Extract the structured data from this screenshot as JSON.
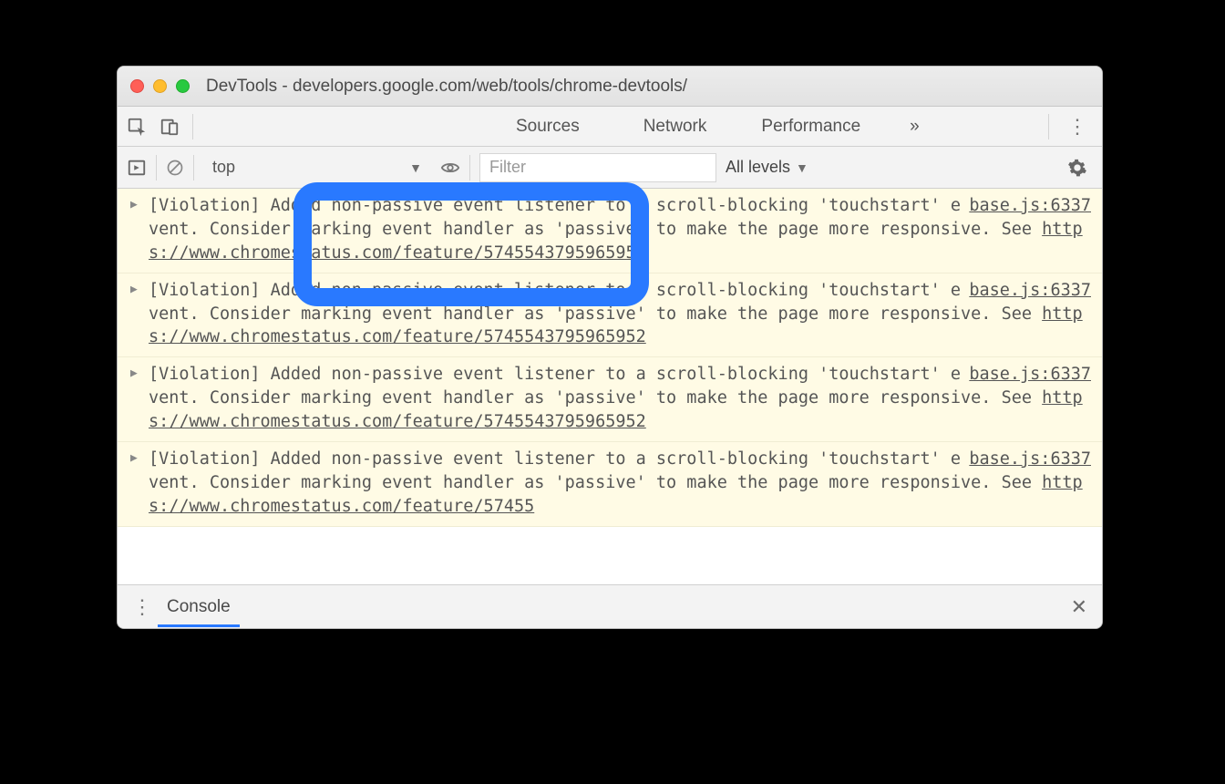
{
  "window": {
    "title": "DevTools - developers.google.com/web/tools/chrome-devtools/"
  },
  "tabs": {
    "sources": "Sources",
    "network": "Network",
    "performance": "Performance",
    "overflow": "»"
  },
  "console_toolbar": {
    "context": "top",
    "filter_placeholder": "Filter",
    "levels": "All levels"
  },
  "messages": [
    {
      "pre": "[Violation] Added non-passive event listener to a scroll-blocking 'touchstart' event. Consider marking event handler as 'passive' to make the page more responsive. See ",
      "link": "https://www.chromestatus.com/feature/5745543795965952",
      "src": "base.js:6337"
    },
    {
      "pre": "[Violation] Added non-passive event listener to a scroll-blocking 'touchstart' event. Consider marking event handler as 'passive' to make the page more responsive. See ",
      "link": "https://www.chromestatus.com/feature/5745543795965952",
      "src": "base.js:6337"
    },
    {
      "pre": "[Violation] Added non-passive event listener to a scroll-blocking 'touchstart' event. Consider marking event handler as 'passive' to make the page more responsive. See ",
      "link": "https://www.chromestatus.com/feature/5745543795965952",
      "src": "base.js:6337"
    },
    {
      "pre": "[Violation] Added non-passive event listener to a scroll-blocking 'touchstart' event. Consider marking event handler as 'passive' to make the page more responsive. See ",
      "link": "https://www.chromestatus.com/feature/57455",
      "src": "base.js:6337"
    }
  ],
  "drawer": {
    "tab": "Console"
  }
}
